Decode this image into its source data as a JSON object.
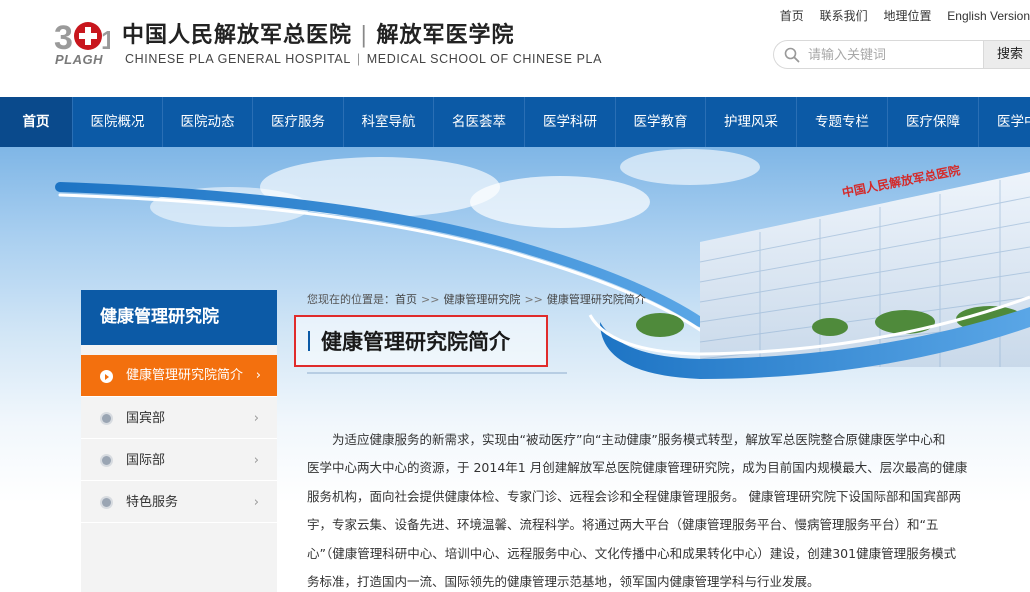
{
  "header": {
    "logo_text": "PLAGH",
    "logo_number": "301",
    "name_cn_1": "中国人民解放军总医院",
    "name_cn_sep": "|",
    "name_cn_2": "解放军医学院",
    "name_en_1": "CHINESE PLA GENERAL HOSPITAL",
    "name_en_sep": "|",
    "name_en_2": "MEDICAL SCHOOL OF CHINESE PLA",
    "top_links": [
      "首页",
      "联系我们",
      "地理位置",
      "English Version"
    ],
    "search_placeholder": "请输入关键词",
    "search_button": "搜索"
  },
  "nav": {
    "items": [
      "首页",
      "医院概况",
      "医院动态",
      "医疗服务",
      "科室导航",
      "名医荟萃",
      "医学科研",
      "医学教育",
      "护理风采",
      "专题专栏",
      "医疗保障",
      "医学中心"
    ],
    "active_index": 0
  },
  "banner": {
    "building_sign": "中国人民解放军总医院"
  },
  "sidebar": {
    "title": "健康管理研究院",
    "items": [
      {
        "label": "健康管理研究院简介",
        "active": true
      },
      {
        "label": "国宾部",
        "active": false
      },
      {
        "label": "国际部",
        "active": false
      },
      {
        "label": "特色服务",
        "active": false
      }
    ],
    "chevron": "›"
  },
  "breadcrumb": {
    "prefix": "您现在的位置是：",
    "items": [
      "首页",
      "健康管理研究院",
      "健康管理研究院简介"
    ],
    "separator": ">>"
  },
  "content": {
    "title": "健康管理研究院简介",
    "paragraph_lines": [
      "为适应健康服务的新需求，实现由“被动医疗”向“主动健康”服务模式转型，解放军总医院整合原健康医学中心和",
      "医学中心两大中心的资源，于 2014年1 月创建解放军总医院健康管理研究院，成为目前国内规模最大、层次最高的健康",
      "服务机构，面向社会提供健康体检、专家门诊、远程会诊和全程健康管理服务。 健康管理研究院下设国际部和国宾部两",
      "宇，专家云集、设备先进、环境温馨、流程科学。将通过两大平台（健康管理服务平台、慢病管理服务平台）和“五",
      "心”（健康管理科研中心、培训中心、远程服务中心、文化传播中心和成果转化中心）建设，创建301健康管理服务模式",
      "务标准，打造国内一流、国际领先的健康管理示范基地，领军国内健康管理学科与行业发展。"
    ]
  },
  "colors": {
    "nav_blue": "#0c5aa6",
    "accent_orange": "#f3700e",
    "highlight_red": "#e02b2b"
  }
}
